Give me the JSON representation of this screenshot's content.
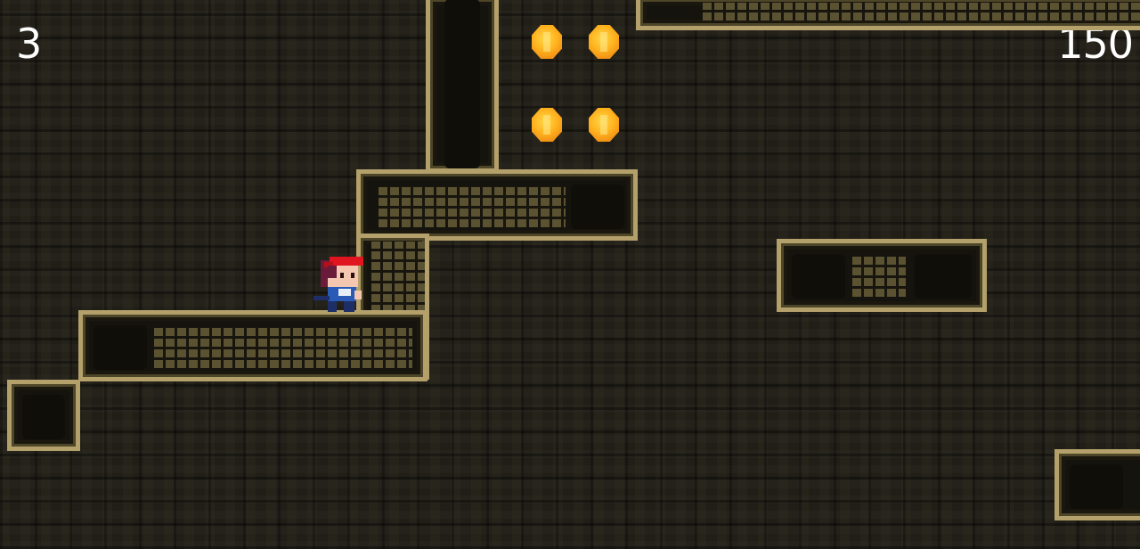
{
  "hud": {
    "lives": "3",
    "score": "150"
  },
  "icons": {
    "player": "player-character-icon",
    "coin": "coin-icon"
  },
  "colors": {
    "background": "#201e17",
    "stone_border": "#b3a06a",
    "coin": "#ffb31f",
    "player_hat": "#e0151f",
    "player_shirt": "#2a5ab5",
    "hud_text": "#ffffff"
  },
  "coins_visible": 4
}
